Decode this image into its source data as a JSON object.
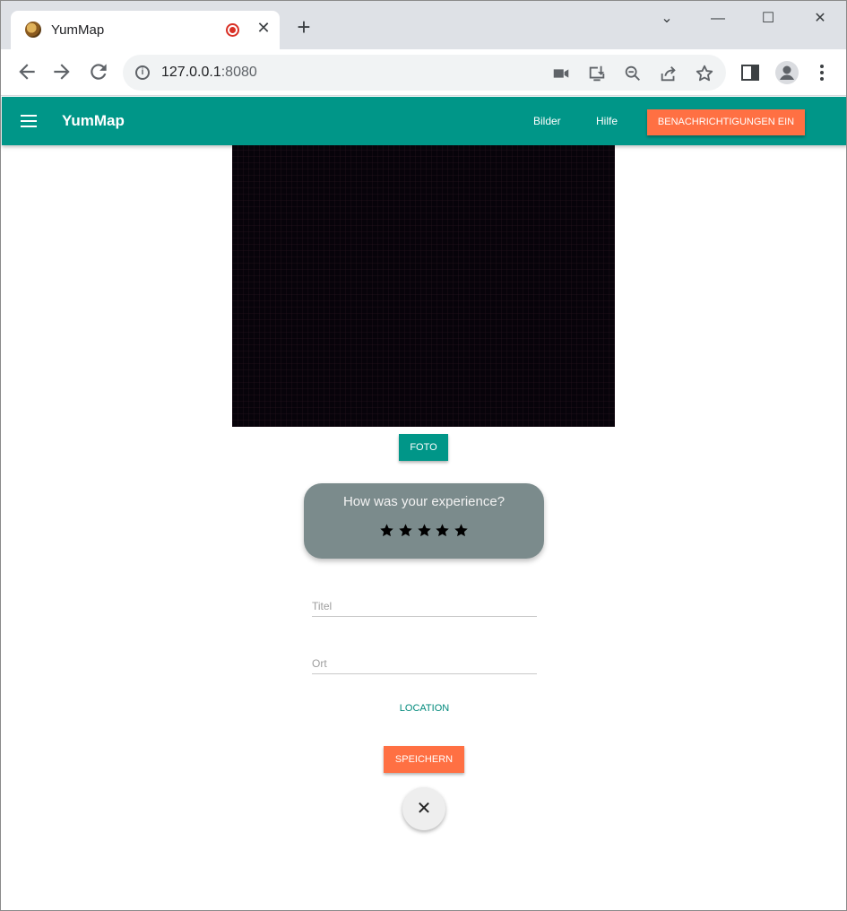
{
  "browser": {
    "tab_title": "YumMap",
    "tab_close": "✕",
    "new_tab": "+",
    "url_host": "127.0.0.1",
    "url_port": ":8080",
    "window_controls": {
      "minimize": "—",
      "maximize": "☐",
      "close": "✕",
      "tab_search": "⌄"
    },
    "icons": [
      "back-icon",
      "forward-icon",
      "reload-icon",
      "info-icon",
      "camera-icon",
      "install-icon",
      "zoom-out-icon",
      "share-icon",
      "bookmark-star-icon",
      "side-panel-icon",
      "profile-icon",
      "menu-kebab-icon"
    ]
  },
  "appbar": {
    "brand": "YumMap",
    "links": [
      "Bilder",
      "Hilfe"
    ],
    "notify_button": "BENACHRICHTIGUNGEN EIN",
    "color": "#009688",
    "accent": "#ff7043"
  },
  "form": {
    "photo_button": "FOTO",
    "rating": {
      "title": "How was your experience?",
      "stars": 5,
      "star_color": "#000000"
    },
    "title_placeholder": "Titel",
    "location_placeholder": "Ort",
    "location_link": "LOCATION",
    "save_button": "SPEICHERN",
    "close_button": "✕"
  }
}
